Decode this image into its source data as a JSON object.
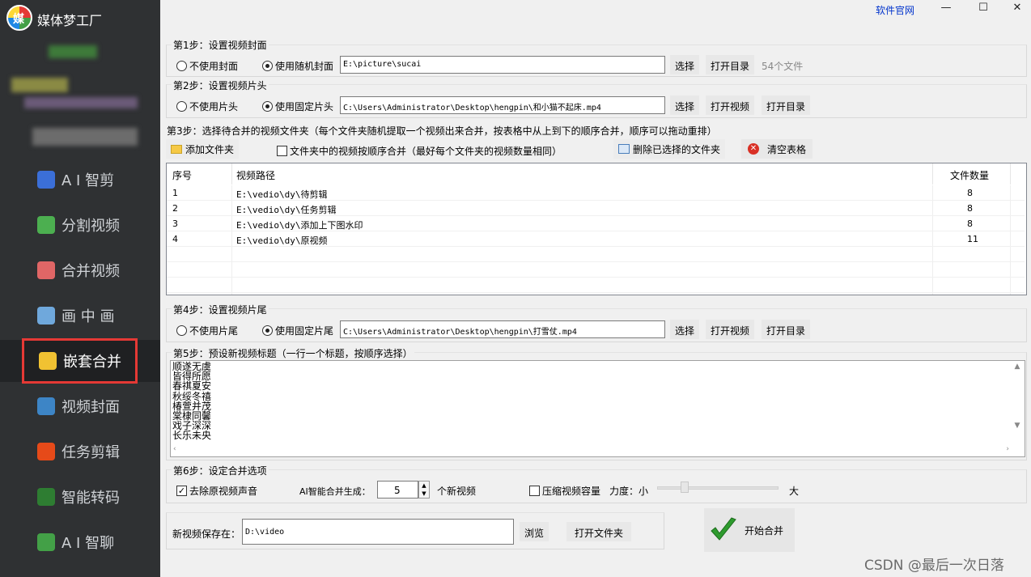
{
  "app": {
    "title": "媒体梦工厂",
    "logo_letter": "媒",
    "site_link": "软件官网"
  },
  "window": {
    "minimize": "—",
    "maximize": "☐",
    "close": "✕"
  },
  "sidebar": {
    "items": [
      {
        "label": "A I 智剪",
        "icon": "ai-clip-icon",
        "color": "#3b6fd8"
      },
      {
        "label": "分割视频",
        "icon": "split-video-icon",
        "color": "#4caf50"
      },
      {
        "label": "合并视频",
        "icon": "merge-video-icon",
        "color": "#e06666"
      },
      {
        "label": "画 中 画",
        "icon": "picture-in-picture-icon",
        "color": "#6fa8dc"
      },
      {
        "label": "嵌套合并",
        "icon": "nested-merge-icon",
        "color": "#f1c232",
        "active": true
      },
      {
        "label": "视频封面",
        "icon": "video-cover-icon",
        "color": "#3d85c6"
      },
      {
        "label": "任务剪辑",
        "icon": "task-clip-icon",
        "color": "#e64a19"
      },
      {
        "label": "智能转码",
        "icon": "transcode-icon",
        "color": "#2e7d32"
      },
      {
        "label": "A I 智聊",
        "icon": "ai-chat-icon",
        "color": "#43a047"
      }
    ]
  },
  "step1": {
    "legend": "第1步：设置视频封面",
    "opt_none": "不使用封面",
    "opt_random": "使用随机封面",
    "path": "E:\\picture\\sucai",
    "select": "选择",
    "open_dir": "打开目录",
    "count": "54个文件"
  },
  "step2": {
    "legend": "第2步：设置视频片头",
    "opt_none": "不使用片头",
    "opt_fixed": "使用固定片头",
    "path": "C:\\Users\\Administrator\\Desktop\\hengpin\\和小猫不起床.mp4",
    "select": "选择",
    "open_video": "打开视频",
    "open_dir": "打开目录"
  },
  "step3": {
    "legend": "第3步：选择待合并的视频文件夹（每个文件夹随机提取一个视频出来合并，按表格中从上到下的顺序合并，顺序可以拖动重排）",
    "add_folder": "添加文件夹",
    "sequential_label": "文件夹中的视频按顺序合并（最好每个文件夹的视频数量相同）",
    "delete_selected": "删除已选择的文件夹",
    "clear_table": "清空表格",
    "columns": [
      "序号",
      "视频路径",
      "文件数量"
    ],
    "rows": [
      {
        "no": "1",
        "path": "E:\\vedio\\dy\\待剪辑",
        "count": "8"
      },
      {
        "no": "2",
        "path": "E:\\vedio\\dy\\任务剪辑",
        "count": "8"
      },
      {
        "no": "3",
        "path": "E:\\vedio\\dy\\添加上下图水印",
        "count": "8"
      },
      {
        "no": "4",
        "path": "E:\\vedio\\dy\\原视频",
        "count": "11"
      }
    ]
  },
  "step4": {
    "legend": "第4步：设置视频片尾",
    "opt_none": "不使用片尾",
    "opt_fixed": "使用固定片尾",
    "path": "C:\\Users\\Administrator\\Desktop\\hengpin\\打雪仗.mp4",
    "select": "选择",
    "open_video": "打开视频",
    "open_dir": "打开目录"
  },
  "step5": {
    "legend": "第5步：预设新视频标题（一行一个标题，按顺序选择）",
    "titles": [
      "顺遂无虞",
      "皆得所愿",
      "春祺夏安",
      "秋绥冬禧",
      "椿萱并茂",
      "棠棣同馨",
      "戏子深深",
      "长乐未央"
    ]
  },
  "step6": {
    "legend": "第6步：设定合并选项",
    "mute_label": "去除原视频声音",
    "gen_label": "AI智能合并生成：",
    "gen_value": "5",
    "gen_suffix": "个新视频",
    "compress_label": "压缩视频容量",
    "strength_label": "力度：小",
    "strength_max": "大",
    "strength_value": 0.2
  },
  "save": {
    "label": "新视频保存在：",
    "path": "D:\\video",
    "browse": "浏览",
    "open_folder": "打开文件夹"
  },
  "start": {
    "label": "开始合并"
  },
  "watermark": "CSDN @最后一次日落"
}
